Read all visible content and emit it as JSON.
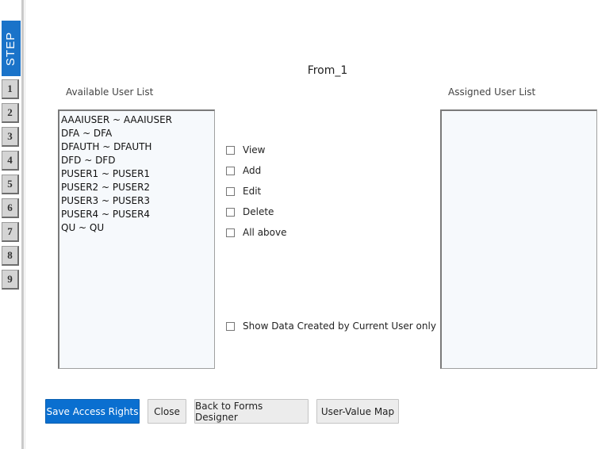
{
  "rail": {
    "step_label": "STEP",
    "steps": [
      "1",
      "2",
      "3",
      "4",
      "5",
      "6",
      "7",
      "8",
      "9"
    ]
  },
  "form": {
    "title": "From_1"
  },
  "available": {
    "label": "Available User List",
    "users": [
      "AAAIUSER ~ AAAIUSER",
      "DFA ~ DFA",
      "DFAUTH ~ DFAUTH",
      "DFD ~ DFD",
      "PUSER1 ~ PUSER1",
      "PUSER2 ~ PUSER2",
      "PUSER3 ~ PUSER3",
      "PUSER4 ~ PUSER4",
      "QU ~ QU"
    ]
  },
  "assigned": {
    "label": "Assigned User List",
    "users": []
  },
  "permissions": {
    "view": "View",
    "add": "Add",
    "edit": "Edit",
    "delete": "Delete",
    "all_above": "All above",
    "current_user_only": "Show Data Created by Current User only"
  },
  "buttons": {
    "save": "Save Access Rights",
    "close": "Close",
    "back": "Back to Forms Designer",
    "user_value_map": "User-Value Map"
  },
  "colors": {
    "accent": "#0a6fd0",
    "step_blue": "#1a73c9"
  }
}
